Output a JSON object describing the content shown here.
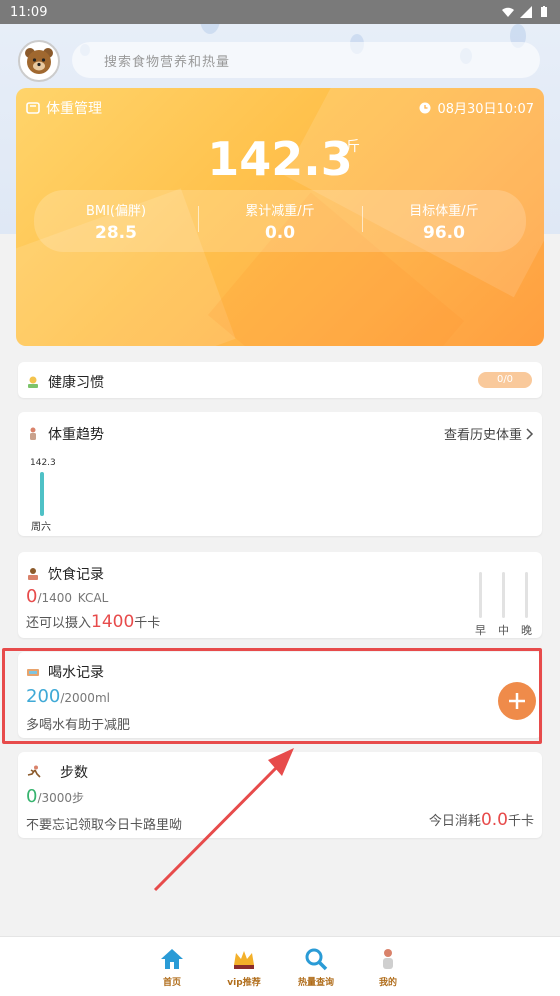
{
  "status_bar": {
    "time": "11:09"
  },
  "search": {
    "placeholder": "搜索食物营养和热量"
  },
  "weight_card": {
    "title": "体重管理",
    "datetime": "08月30日10:07",
    "weight": "142.3",
    "unit": "斤",
    "stats": [
      {
        "label": "BMI(偏胖)",
        "value": "28.5"
      },
      {
        "label": "累计减重/斤",
        "value": "0.0"
      },
      {
        "label": "目标体重/斤",
        "value": "96.0"
      }
    ]
  },
  "habits": {
    "title": "健康习惯",
    "progress": "0/0"
  },
  "trend": {
    "title": "体重趋势",
    "link": "查看历史体重",
    "point_value": "142.3",
    "point_day": "周六"
  },
  "diet": {
    "title": "饮食记录",
    "current": "0",
    "total": "/1400",
    "unit": "KCAL",
    "remaining_prefix": "还可以摄入",
    "remaining_value": "1400",
    "remaining_unit": "千卡",
    "meals": [
      "早",
      "中",
      "晚"
    ]
  },
  "water": {
    "title": "喝水记录",
    "current": "200",
    "total": "/2000ml",
    "note": "多喝水有助于减肥"
  },
  "steps": {
    "title": "步数",
    "current": "0",
    "total": "/3000步",
    "note": "不要忘记领取今日卡路里呦",
    "burn_prefix": "今日消耗",
    "burn_value": "0.0",
    "burn_unit": "千卡"
  },
  "bottom_nav": [
    {
      "label": "首页",
      "icon": "home-icon"
    },
    {
      "label": "vip推荐",
      "icon": "vip-crown-icon"
    },
    {
      "label": "热量查询",
      "icon": "search-icon"
    },
    {
      "label": "我的",
      "icon": "profile-icon"
    }
  ],
  "colors": {
    "accent_orange": "#ef8b4a",
    "red": "#e74b4b",
    "water_blue": "#3fa9d6",
    "step_green": "#36b36e",
    "trend_teal": "#4fc1c6"
  }
}
